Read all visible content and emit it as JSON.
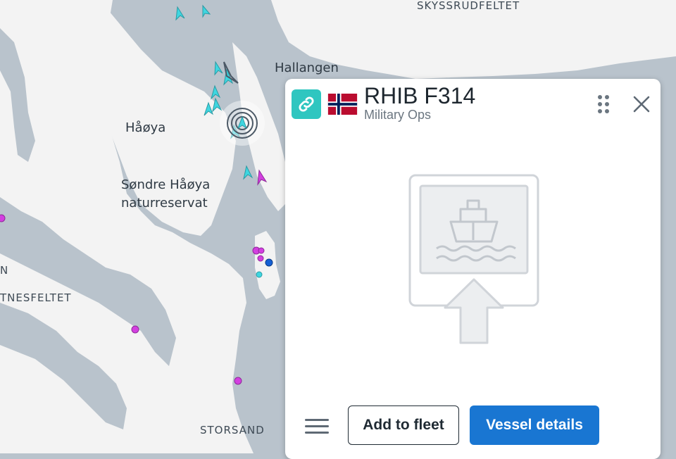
{
  "map": {
    "labels": {
      "skyssrud": "SKYSSRUDFELTET",
      "hallangen": "Hallangen",
      "haoya": "Håøya",
      "sondre_line1": "Søndre Håøya",
      "sondre_line2": "naturreservat",
      "tnesfeltet": "TNESFELTET",
      "n_edge": "N",
      "storsand": "STORSAND"
    },
    "colors": {
      "water": "#b9c3cc",
      "land": "#f4f4f4",
      "vessel_cyan": "#3fd6e0",
      "vessel_magenta": "#d33fe0",
      "vessel_blue": "#1560d4",
      "selected_vessel": "#4c5966"
    }
  },
  "panel": {
    "vessel_name": "RHIB F314",
    "vessel_type": "Military Ops",
    "flag": "norway-flag",
    "link_icon": "link-icon",
    "add_to_fleet_label": "Add to fleet",
    "vessel_details_label": "Vessel details",
    "colors": {
      "link_button": "#2fc6c0",
      "primary_button": "#1976d2"
    }
  }
}
